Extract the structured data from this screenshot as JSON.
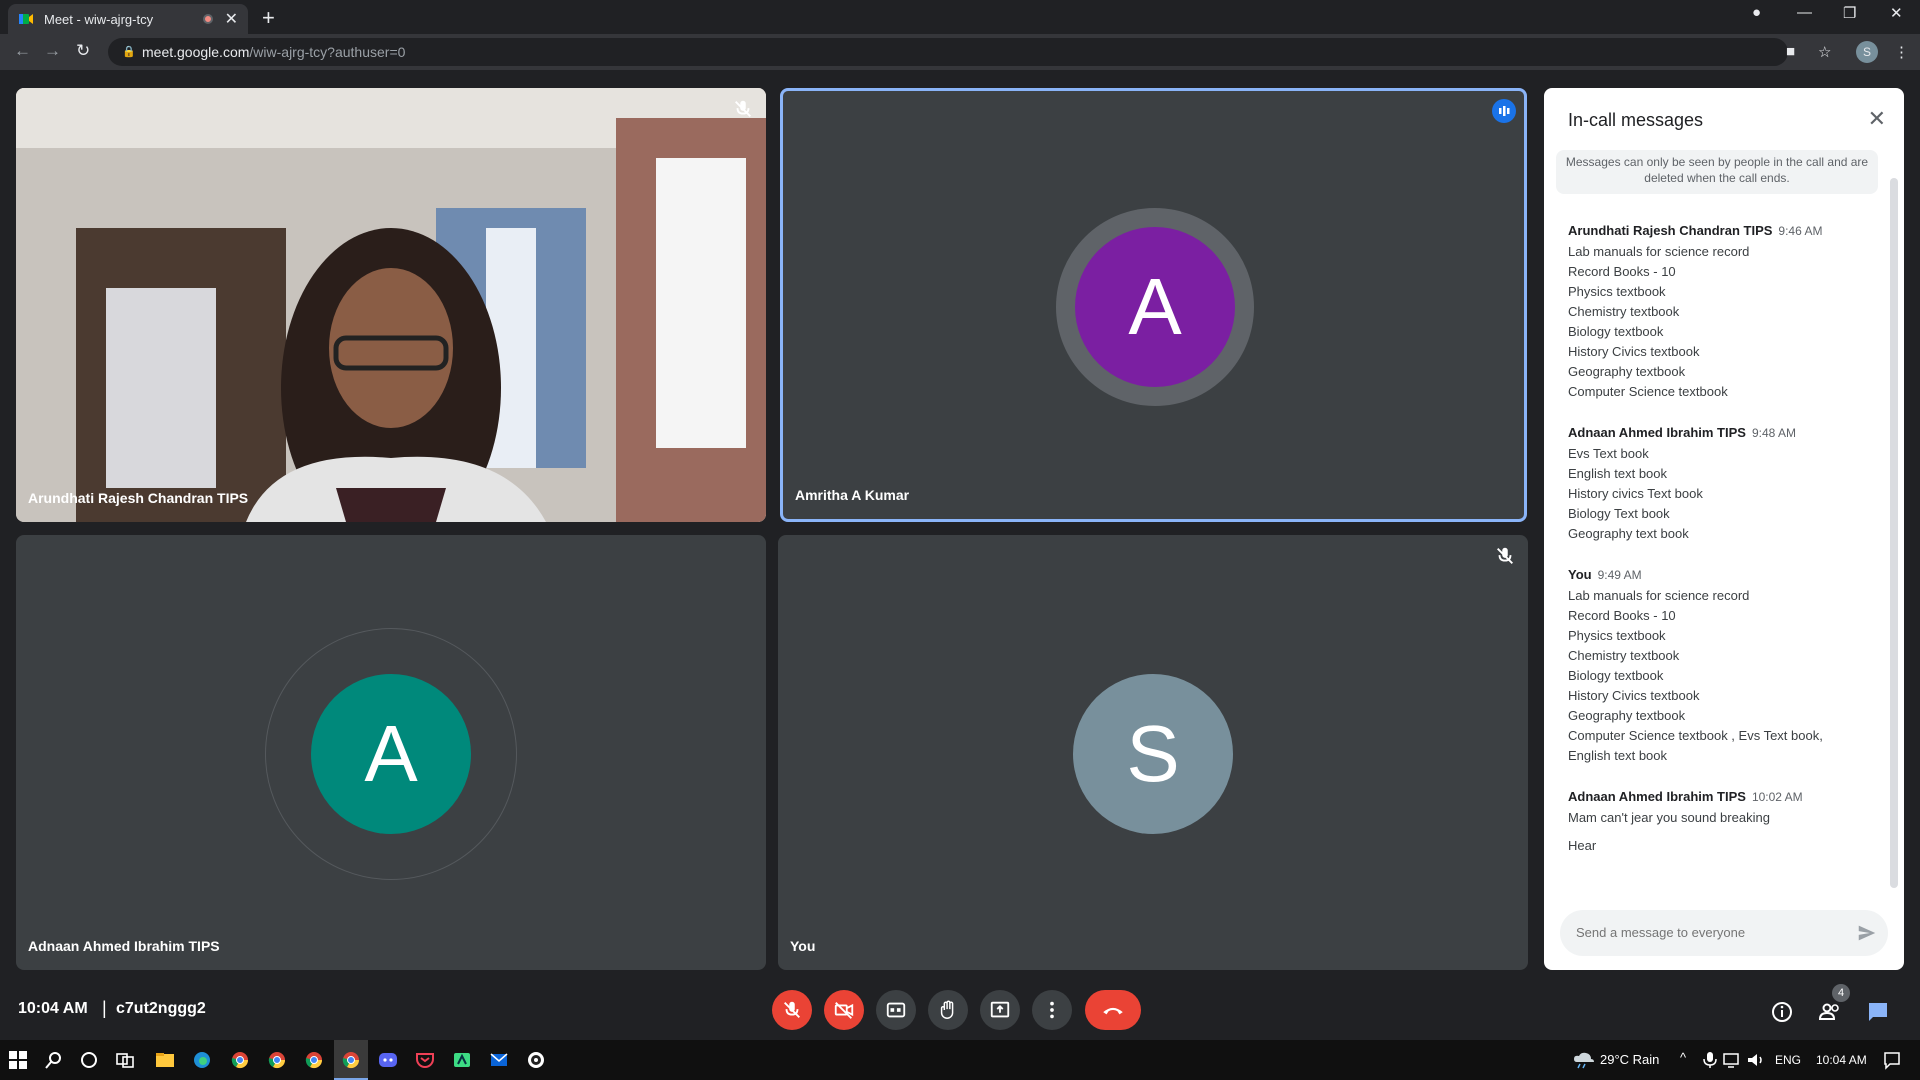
{
  "browser": {
    "tab_title": "Meet - wiw-ajrg-tcy",
    "new_tab": "+",
    "url_host": "meet.google.com",
    "url_path": "/wiw-ajrg-tcy?authuser=0",
    "profile_initial": "S"
  },
  "tiles": [
    {
      "name": "Arundhati Rajesh Chandran TIPS",
      "muted": true,
      "video": true
    },
    {
      "name": "Amritha A Kumar",
      "initial": "A",
      "avatar_color": "#7b1fa2",
      "speaking": true
    },
    {
      "name": "Adnaan Ahmed Ibrahim TIPS",
      "initial": "A",
      "avatar_color": "#00897b"
    },
    {
      "name": "You",
      "initial": "S",
      "avatar_color": "#78909c",
      "muted": true
    }
  ],
  "chat": {
    "title": "In-call messages",
    "note": "Messages can only be seen by people in the call and are deleted when the call ends.",
    "input_placeholder": "Send a message to everyone",
    "messages": [
      {
        "sender": "Arundhati Rajesh Chandran TIPS",
        "time": "9:46 AM",
        "lines": [
          "Lab manuals for science record",
          "Record Books - 10",
          "Physics textbook",
          "Chemistry textbook",
          "Biology textbook",
          "History Civics textbook",
          "Geography textbook",
          "Computer Science textbook"
        ]
      },
      {
        "sender": "Adnaan Ahmed Ibrahim TIPS",
        "time": "9:48 AM",
        "lines": [
          "Evs Text book",
          "English text book",
          "History civics Text book",
          "Biology Text book",
          "Geography text book"
        ]
      },
      {
        "sender": "You",
        "time": "9:49 AM",
        "lines": [
          "Lab manuals for science record",
          "Record Books - 10",
          "Physics textbook",
          "Chemistry textbook",
          "Biology textbook",
          "History Civics textbook",
          "Geography textbook",
          "Computer Science textbook , Evs Text book,",
          "English text book"
        ]
      },
      {
        "sender": "Adnaan Ahmed Ibrahim TIPS",
        "time": "10:02 AM",
        "lines": [
          "Mam can't jear you sound breaking",
          "",
          "Hear"
        ]
      }
    ]
  },
  "meeting": {
    "time": "10:04 AM",
    "separator": "|",
    "code": "c7ut2nggg2",
    "people_count": "4"
  },
  "taskbar": {
    "weather": "29°C  Rain",
    "lang": "ENG",
    "clock": "10:04 AM"
  },
  "colors": {
    "accent_blue": "#8ab4f8",
    "danger_red": "#ea4335",
    "tile_bg": "#3c4043"
  }
}
